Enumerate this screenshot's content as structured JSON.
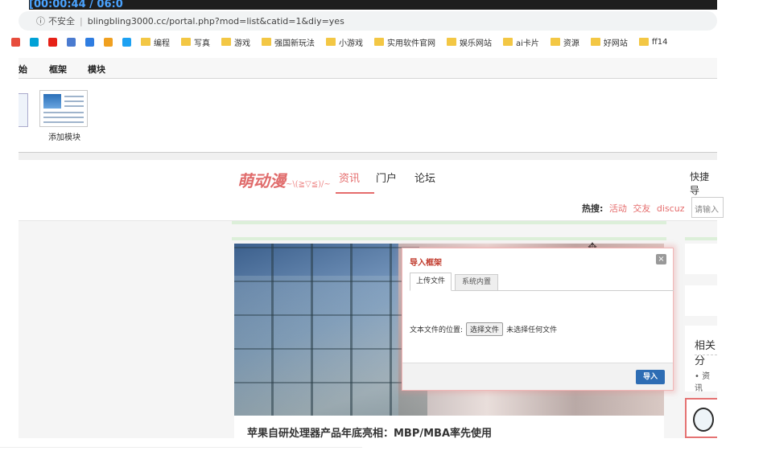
{
  "browser": {
    "cap_text": "[00:00:44 / 06:0",
    "insecure_label": "不安全",
    "url": "blingbling3000.cc/portal.php?mod=list&catid=1&diy=yes",
    "bookmarks": [
      "编程",
      "写真",
      "游戏",
      "强国新玩法",
      "小游戏",
      "实用软件官网",
      "娱乐网站",
      "ai卡片",
      "资源",
      "好网站",
      "ff14"
    ]
  },
  "diy": {
    "tabs": [
      "始",
      "框架",
      "模块"
    ],
    "add_module_label": "添加模块"
  },
  "site": {
    "logo_text": "萌动漫",
    "logo_suffix": "~\\(≧▽≦)/~",
    "nav": [
      "资讯",
      "门户",
      "论坛"
    ],
    "quick_label": "快捷导",
    "hot_label": "热搜:",
    "hot_links": [
      "活动",
      "交友",
      "discuz"
    ],
    "search_placeholder": "请输入"
  },
  "main": {
    "article_title": "苹果自研处理器产品年底亮相：MBP/MBA率先使用",
    "side_title": "相关分",
    "side_item": "• 资讯"
  },
  "dialog": {
    "title": "导入框架",
    "close": "×",
    "tab_upload": "上传文件",
    "tab_builtin": "系统内置",
    "file_label": "文本文件的位置:",
    "choose_button": "选择文件",
    "no_file": "未选择任何文件",
    "import_button": "导入"
  },
  "colors": {
    "accent": "#e56c6c",
    "primary_button": "#2e6db4"
  }
}
